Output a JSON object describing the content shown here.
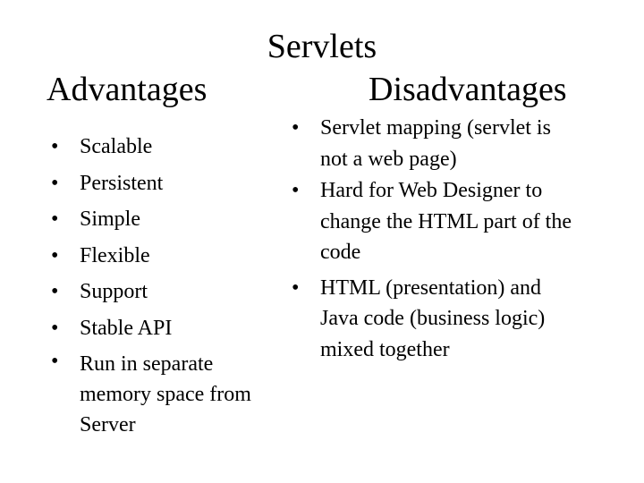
{
  "slide": {
    "title": "Servlets",
    "left": {
      "heading": "Advantages",
      "bullet_glyph": "•",
      "items": [
        "Scalable",
        "Persistent",
        "Simple",
        "Flexible",
        "Support",
        "Stable API",
        "Run in separate memory space from Server"
      ]
    },
    "right": {
      "heading": "Disadvantages",
      "bullet_glyph": "•",
      "items": [
        "Servlet mapping (servlet is not a web page)",
        "Hard for Web Designer to change the HTML part of the code",
        "HTML (presentation) and Java code (business logic) mixed together"
      ]
    }
  }
}
